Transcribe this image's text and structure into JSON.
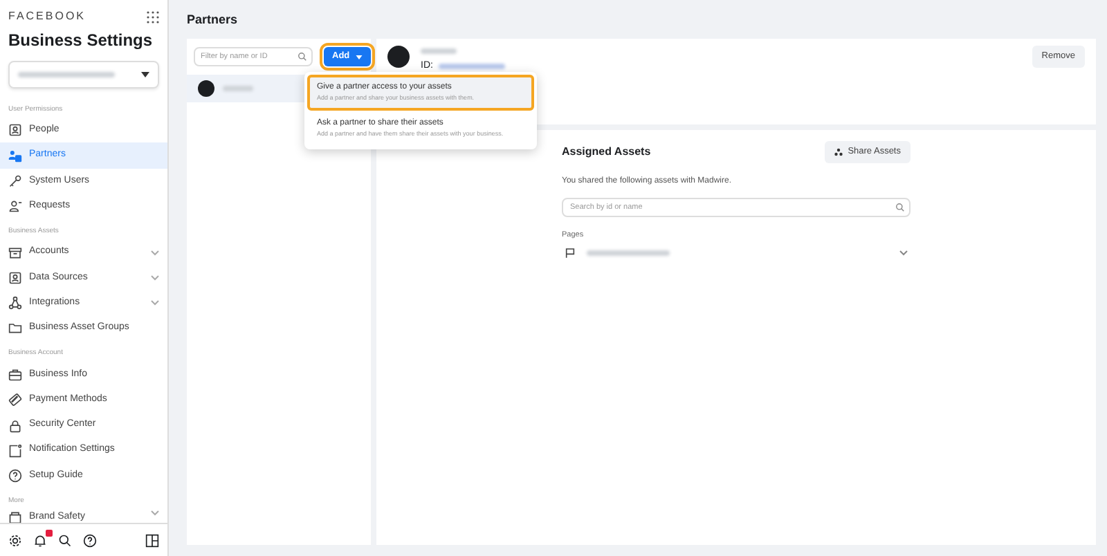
{
  "brand": "FACEBOOK",
  "title": "Business Settings",
  "sidebar": {
    "sections": [
      {
        "heading": "User Permissions",
        "items": [
          {
            "label": "People",
            "selected": false,
            "expandable": false
          },
          {
            "label": "Partners",
            "selected": true,
            "expandable": false
          },
          {
            "label": "System Users",
            "selected": false,
            "expandable": false
          },
          {
            "label": "Requests",
            "selected": false,
            "expandable": false
          }
        ]
      },
      {
        "heading": "Business Assets",
        "items": [
          {
            "label": "Accounts",
            "selected": false,
            "expandable": true
          },
          {
            "label": "Data Sources",
            "selected": false,
            "expandable": true
          },
          {
            "label": "Integrations",
            "selected": false,
            "expandable": true
          },
          {
            "label": "Business Asset Groups",
            "selected": false,
            "expandable": false
          }
        ]
      },
      {
        "heading": "Business Account",
        "items": [
          {
            "label": "Business Info",
            "selected": false,
            "expandable": false
          },
          {
            "label": "Payment Methods",
            "selected": false,
            "expandable": false
          },
          {
            "label": "Security Center",
            "selected": false,
            "expandable": false
          },
          {
            "label": "Notification Settings",
            "selected": false,
            "expandable": false
          },
          {
            "label": "Setup Guide",
            "selected": false,
            "expandable": false
          }
        ]
      },
      {
        "heading": "More",
        "items": [
          {
            "label": "Brand Safety",
            "selected": false,
            "expandable": true
          }
        ]
      }
    ]
  },
  "page_title": "Partners",
  "filter": {
    "placeholder": "Filter by name or ID"
  },
  "add_button": "Add",
  "menu": [
    {
      "title": "Give a partner access to your assets",
      "subtitle": "Add a partner and share your business assets with them.",
      "selected": true
    },
    {
      "title": "Ask a partner to share their assets",
      "subtitle": "Add a partner and have them share their assets with your business.",
      "selected": false
    }
  ],
  "remove_button": "Remove",
  "id_label": "ID:",
  "assets": {
    "title": "Assigned Assets",
    "share_button": "Share Assets",
    "description": "You shared the following assets with Madwire.",
    "search_placeholder": "Search by id or name",
    "group_label": "Pages"
  }
}
